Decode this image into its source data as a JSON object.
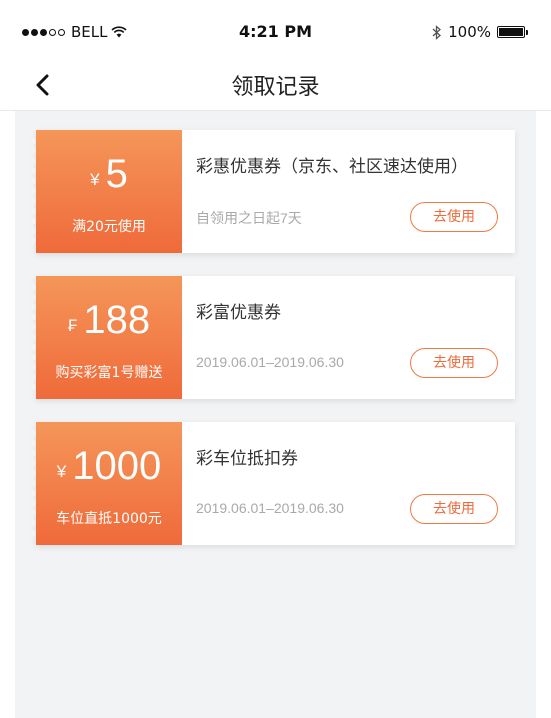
{
  "status_bar": {
    "carrier": "BELL",
    "time": "4:21 PM",
    "battery": "100%"
  },
  "nav": {
    "title": "领取记录",
    "back_icon": "chevron-left-icon"
  },
  "coupons": [
    {
      "currency": "¥",
      "amount": "5",
      "condition": "满20元使用",
      "title": "彩惠优惠券（京东、社区速达使用）",
      "validity": "自领用之日起7天",
      "button": "去使用"
    },
    {
      "currency": "₣",
      "amount": "188",
      "condition": "购买彩富1号赠送",
      "title": "彩富优惠券",
      "validity": "2019.06.01–2019.06.30",
      "button": "去使用"
    },
    {
      "currency": "¥",
      "amount": "1000",
      "condition": "车位直抵1000元",
      "title": "彩车位抵扣券",
      "validity": "2019.06.01–2019.06.30",
      "button": "去使用"
    }
  ],
  "colors": {
    "accent": "#ef6a3a",
    "background": "#f2f3f5"
  }
}
